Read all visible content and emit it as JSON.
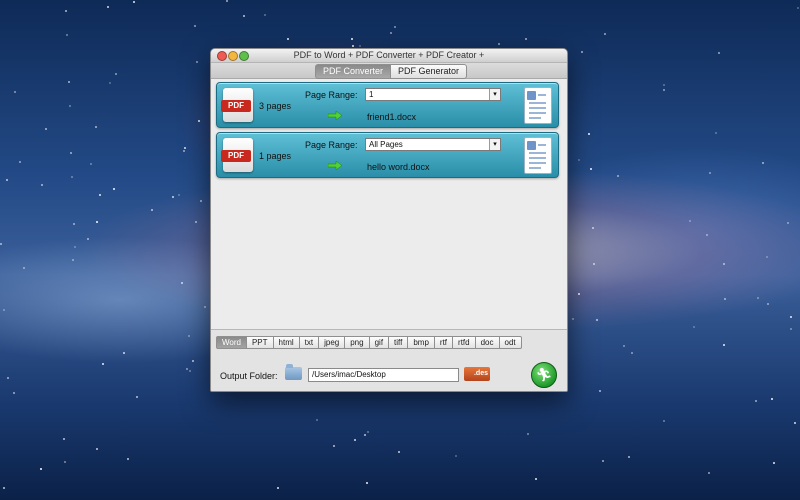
{
  "window": {
    "title": "PDF to Word + PDF Converter + PDF Creator +"
  },
  "tabs": [
    {
      "label": "PDF Converter",
      "active": true
    },
    {
      "label": "PDF Generator",
      "active": false
    }
  ],
  "files": [
    {
      "icon_label": "PDF",
      "pages": "3 pages",
      "range_label": "Page Range:",
      "range_value": "1",
      "output_name": "friend1.docx"
    },
    {
      "icon_label": "PDF",
      "pages": "1 pages",
      "range_label": "Page Range:",
      "range_value": "All Pages",
      "output_name": "hello word.docx"
    }
  ],
  "formats": [
    "Word",
    "PPT",
    "html",
    "txt",
    "jpeg",
    "png",
    "gif",
    "tiff",
    "bmp",
    "rtf",
    "rtfd",
    "doc",
    "odt"
  ],
  "selected_format": "Word",
  "output": {
    "label": "Output Folder:",
    "path": "/Users/imac/Desktop",
    "des_badge": ".des"
  },
  "colors": {
    "row_accent": "#2a8ea8",
    "pdf_badge": "#c8281e",
    "go_button": "#1f9a2a"
  }
}
